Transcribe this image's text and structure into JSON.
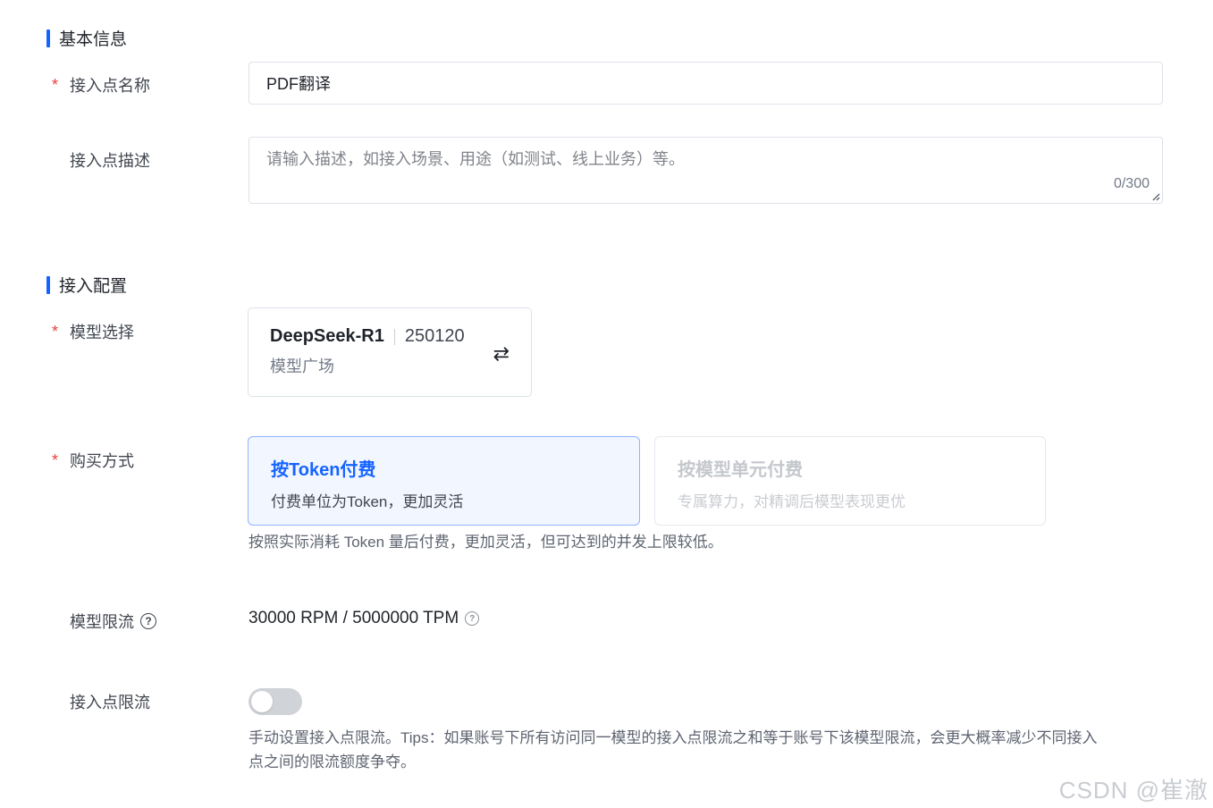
{
  "basic_info": {
    "section_title": "基本信息",
    "endpoint_name": {
      "label": "接入点名称",
      "required": "*",
      "value": "PDF翻译"
    },
    "endpoint_desc": {
      "label": "接入点描述",
      "placeholder": "请输入描述，如接入场景、用途（如测试、线上业务）等。",
      "counter": "0/300"
    }
  },
  "access_config": {
    "section_title": "接入配置",
    "model_select": {
      "label": "模型选择",
      "required": "*",
      "model_name": "DeepSeek-R1",
      "model_version": "250120",
      "source": "模型广场",
      "swap_icon": "⇄"
    },
    "purchase": {
      "label": "购买方式",
      "required": "*",
      "options": [
        {
          "title": "按Token付费",
          "desc": "付费单位为Token，更加灵活",
          "state": "selected"
        },
        {
          "title": "按模型单元付费",
          "desc": "专属算力，对精调后模型表现更优",
          "state": "disabled"
        }
      ],
      "hint": "按照实际消耗 Token 量后付费，更加灵活，但可达到的并发上限较低。"
    },
    "model_rate_limit": {
      "label": "模型限流",
      "value": "30000 RPM / 5000000 TPM"
    },
    "endpoint_rate_limit": {
      "label": "接入点限流",
      "enabled": false,
      "hint_line1": "手动设置接入点限流。Tips：如果账号下所有访问同一模型的接入点限流之和等于账号下该模型限流，会更大概率减少不同接入",
      "hint_line2": "点之间的限流额度争夺。"
    }
  },
  "watermark": "CSDN @崔澈",
  "colors": {
    "primary": "#1664ff",
    "required": "#e8403d",
    "border": "#dde2e9"
  }
}
